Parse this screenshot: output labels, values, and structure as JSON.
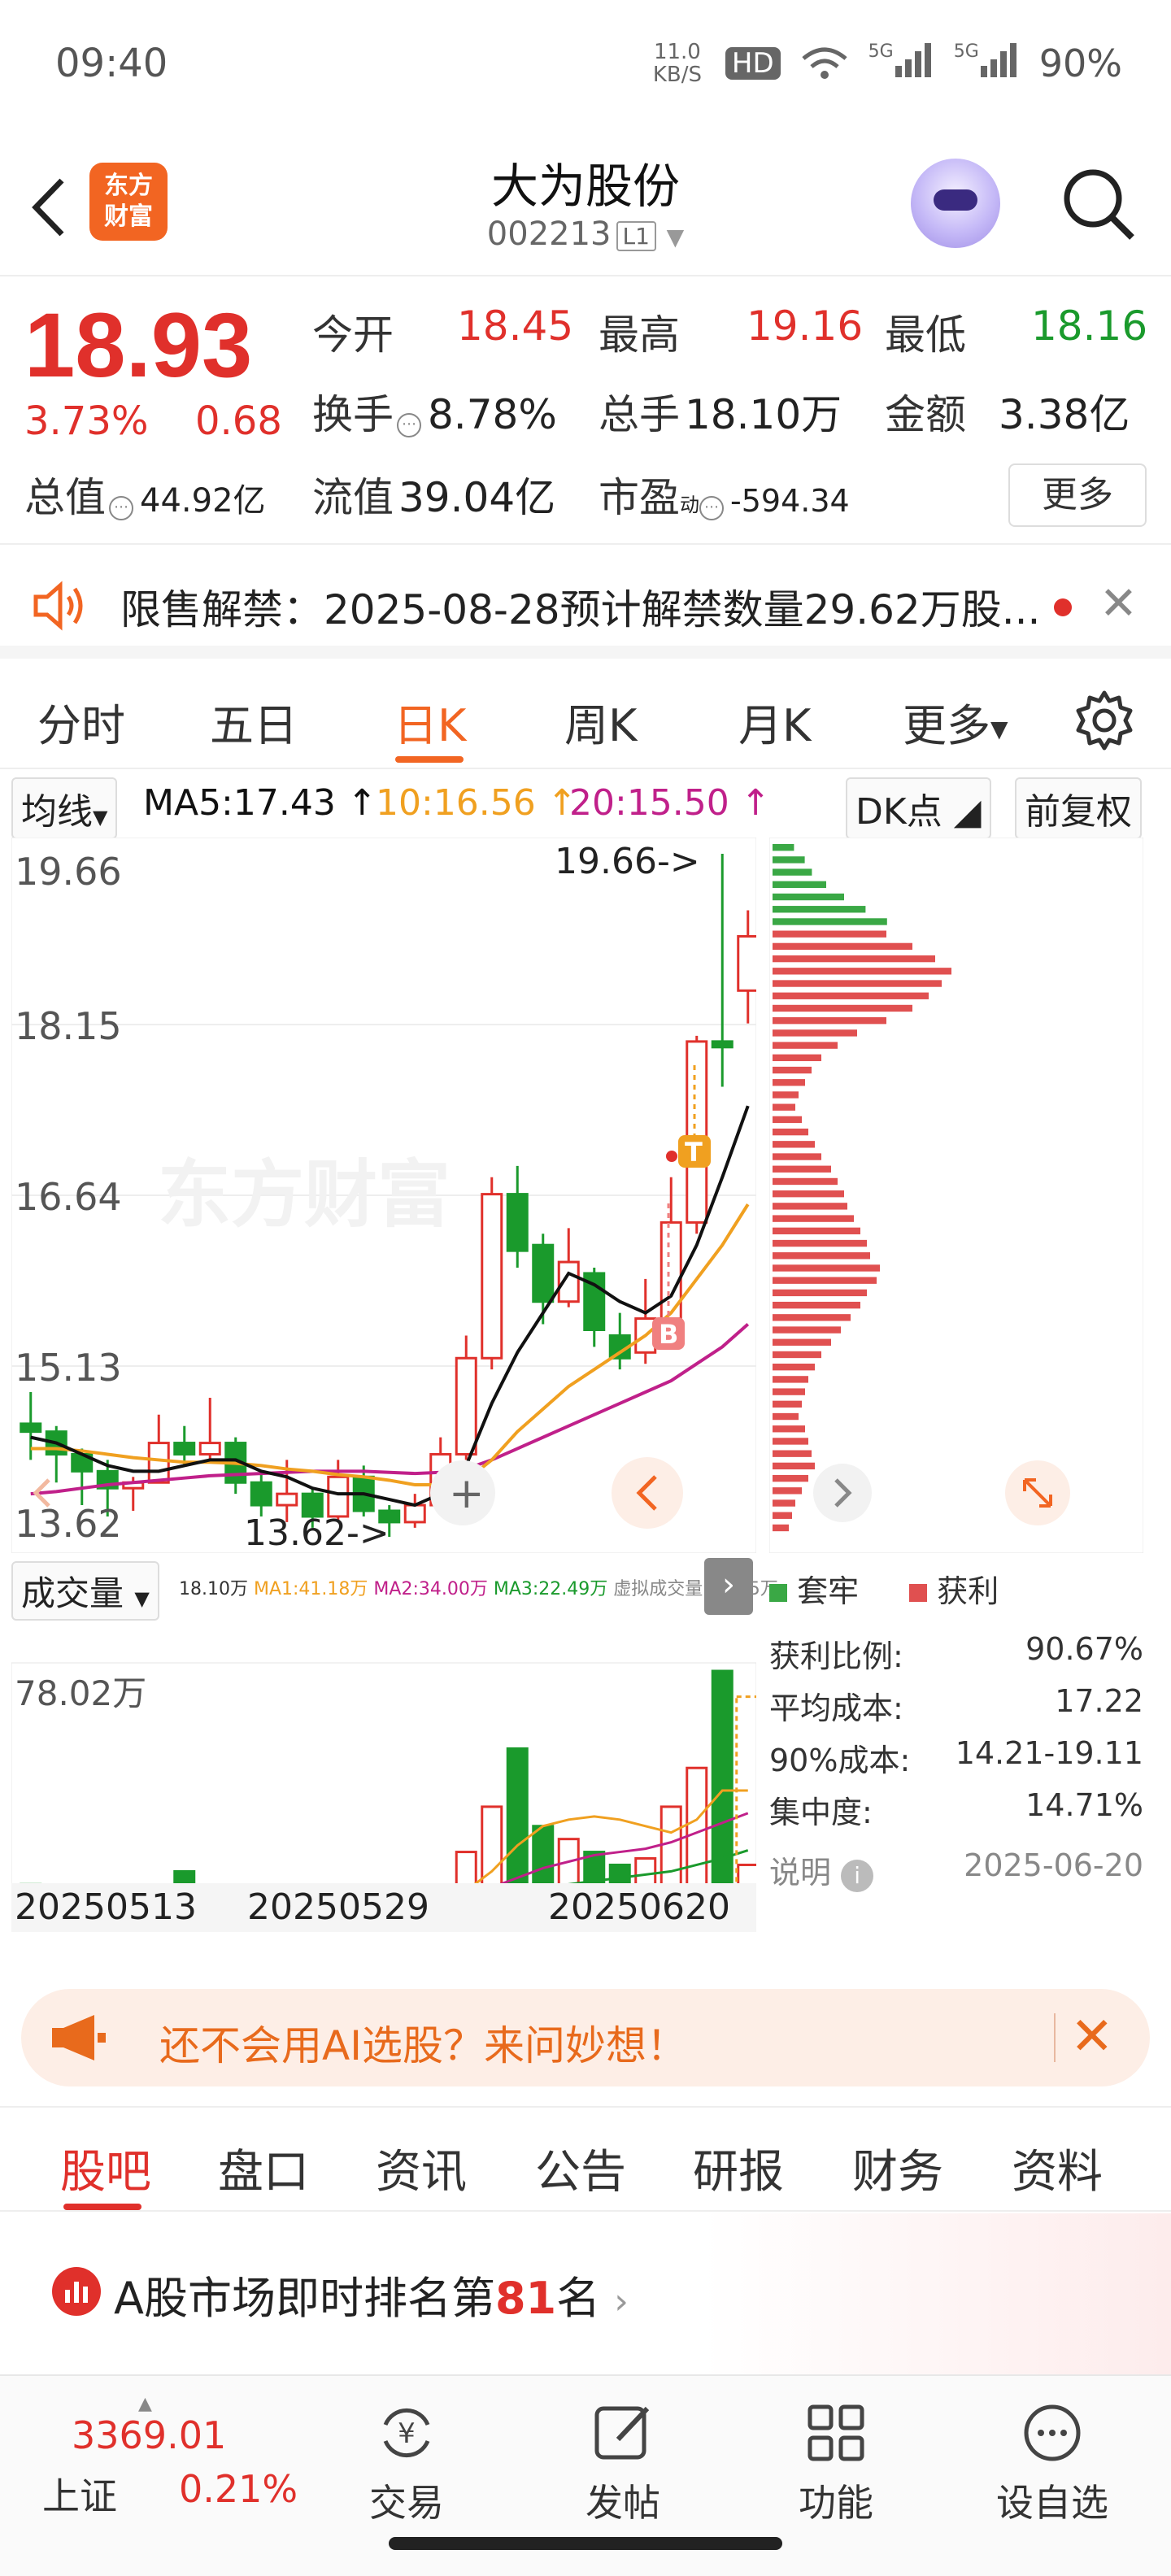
{
  "status_bar": {
    "time": "09:40",
    "speed": "11.0 KB/S",
    "hd": "HD",
    "battery": "90%",
    "net1": "5G",
    "net2": "5G"
  },
  "header": {
    "stock_name": "大为股份",
    "stock_code": "002213",
    "market_tag": "L1",
    "logo_text_1": "东方",
    "logo_text_2": "财富"
  },
  "quote": {
    "price": "18.93",
    "change_pct": "3.73%",
    "change_amt": "0.68",
    "open_label": "今开",
    "open": "18.45",
    "high_label": "最高",
    "high": "19.16",
    "low_label": "最低",
    "low": "18.16",
    "turnover_label": "换手",
    "turnover": "8.78%",
    "volume_label": "总手",
    "volume": "18.10万",
    "amount_label": "金额",
    "amount": "3.38亿",
    "mktcap_label": "总值",
    "mktcap": "44.92亿",
    "float_label": "流值",
    "float_cap": "39.04亿",
    "pe_label": "市盈",
    "pe_sup": "动",
    "pe": "-594.34",
    "more_button": "更多"
  },
  "notice": {
    "text": "限售解禁：2025-08-28预计解禁数量29.62万股..."
  },
  "chart_tabs": [
    "分时",
    "五日",
    "日K",
    "周K",
    "月K",
    "更多"
  ],
  "ma_row": {
    "selector": "均线",
    "ma5": "MA5:17.43",
    "ma10": "10:16.56",
    "ma20": "20:15.50",
    "dk": "DK点",
    "adjust": "前复权"
  },
  "kchart": {
    "y_labels": [
      "19.66",
      "18.15",
      "16.64",
      "15.13",
      "13.62"
    ],
    "max_marker": "19.66->",
    "min_marker": "13.62->",
    "watermark": "东方财富",
    "buy_marker": "B",
    "sell_marker": "T"
  },
  "volume": {
    "selector": "成交量",
    "v": "18.10万",
    "ma1": "MA1:41.18万",
    "ma2": "MA2:34.00万",
    "ma3": "MA3:22.49万",
    "virtual": "虚拟成交量:70.05万",
    "y_max": "78.02万",
    "dates": [
      "20250513",
      "20250529",
      "20250620"
    ]
  },
  "distribution": {
    "legend_trapped": "套牢",
    "legend_profit": "获利",
    "rows": [
      {
        "label": "获利比例:",
        "value": "90.67%"
      },
      {
        "label": "平均成本:",
        "value": "17.22"
      },
      {
        "label": "90%成本:",
        "value": "14.21-19.11"
      },
      {
        "label": "集中度:",
        "value": "14.71%"
      }
    ],
    "note_label": "说明",
    "date": "2025-06-20"
  },
  "ai_banner": {
    "text": "还不会用AI选股？来问妙想！"
  },
  "bottom_tabs": [
    "股吧",
    "盘口",
    "资讯",
    "公告",
    "研报",
    "财务",
    "资料"
  ],
  "rank": {
    "prefix": "A股市场即时排名第",
    "rank": "81",
    "suffix": "名"
  },
  "nav": {
    "index_value": "3369.01",
    "index_name": "上证",
    "index_change": "0.21%",
    "trade": "交易",
    "post": "发帖",
    "function": "功能",
    "watchlist": "设自选"
  },
  "colors": {
    "up": "#e0302b",
    "down": "#1a9a2c",
    "accent": "#f26522",
    "ma5": "#111111",
    "ma10": "#f0a020",
    "ma20": "#c0208a"
  },
  "chart_data": {
    "type": "candlestick",
    "y_range": [
      13.62,
      19.66
    ],
    "candles": [
      {
        "o": 14.62,
        "c": 14.55,
        "h": 14.9,
        "l": 14.3
      },
      {
        "o": 14.55,
        "c": 14.35,
        "h": 14.6,
        "l": 14.1
      },
      {
        "o": 14.35,
        "c": 14.2,
        "h": 14.4,
        "l": 13.9
      },
      {
        "o": 14.2,
        "c": 14.05,
        "h": 14.3,
        "l": 13.8
      },
      {
        "o": 14.05,
        "c": 14.1,
        "h": 14.15,
        "l": 13.85
      },
      {
        "o": 14.1,
        "c": 14.45,
        "h": 14.7,
        "l": 14.1
      },
      {
        "o": 14.45,
        "c": 14.35,
        "h": 14.6,
        "l": 14.25
      },
      {
        "o": 14.35,
        "c": 14.45,
        "h": 14.85,
        "l": 14.3
      },
      {
        "o": 14.45,
        "c": 14.1,
        "h": 14.5,
        "l": 14.0
      },
      {
        "o": 14.1,
        "c": 13.9,
        "h": 14.2,
        "l": 13.8
      },
      {
        "o": 13.9,
        "c": 14.0,
        "h": 14.3,
        "l": 13.75
      },
      {
        "o": 14.0,
        "c": 13.8,
        "h": 14.05,
        "l": 13.7
      },
      {
        "o": 13.8,
        "c": 14.15,
        "h": 14.3,
        "l": 13.75
      },
      {
        "o": 14.15,
        "c": 13.85,
        "h": 14.25,
        "l": 13.8
      },
      {
        "o": 13.85,
        "c": 13.75,
        "h": 13.9,
        "l": 13.62
      },
      {
        "o": 13.75,
        "c": 13.9,
        "h": 14.0,
        "l": 13.7
      },
      {
        "o": 13.9,
        "c": 14.35,
        "h": 14.5,
        "l": 13.9
      },
      {
        "o": 14.35,
        "c": 15.2,
        "h": 15.4,
        "l": 14.3
      },
      {
        "o": 15.2,
        "c": 16.65,
        "h": 16.8,
        "l": 15.1
      },
      {
        "o": 16.65,
        "c": 16.15,
        "h": 16.9,
        "l": 16.0
      },
      {
        "o": 16.2,
        "c": 15.7,
        "h": 16.3,
        "l": 15.5
      },
      {
        "o": 15.7,
        "c": 16.05,
        "h": 16.35,
        "l": 15.65
      },
      {
        "o": 15.95,
        "c": 15.45,
        "h": 16.0,
        "l": 15.3
      },
      {
        "o": 15.4,
        "c": 15.2,
        "h": 15.6,
        "l": 15.1
      },
      {
        "o": 15.25,
        "c": 15.55,
        "h": 15.9,
        "l": 15.15
      },
      {
        "o": 15.55,
        "c": 16.4,
        "h": 16.8,
        "l": 15.5
      },
      {
        "o": 16.4,
        "c": 18.0,
        "h": 18.05,
        "l": 16.3
      },
      {
        "o": 18.0,
        "c": 17.95,
        "h": 19.66,
        "l": 17.6
      },
      {
        "o": 18.45,
        "c": 18.93,
        "h": 19.16,
        "l": 18.16
      }
    ],
    "ma5": [
      14.5,
      14.45,
      14.35,
      14.25,
      14.2,
      14.2,
      14.25,
      14.3,
      14.3,
      14.2,
      14.15,
      14.05,
      14.0,
      14.0,
      13.95,
      13.9,
      14.0,
      14.25,
      14.8,
      15.25,
      15.6,
      15.95,
      15.85,
      15.7,
      15.6,
      15.75,
      16.2,
      16.8,
      17.43
    ],
    "ma10": [
      14.4,
      14.4,
      14.38,
      14.35,
      14.32,
      14.3,
      14.28,
      14.28,
      14.27,
      14.25,
      14.22,
      14.2,
      14.17,
      14.15,
      14.12,
      14.08,
      14.08,
      14.12,
      14.3,
      14.55,
      14.75,
      14.95,
      15.1,
      15.25,
      15.4,
      15.6,
      15.9,
      16.2,
      16.56
    ],
    "ma20": [
      14.0,
      14.02,
      14.05,
      14.08,
      14.1,
      14.12,
      14.14,
      14.16,
      14.17,
      14.18,
      14.19,
      14.2,
      14.2,
      14.2,
      14.19,
      14.18,
      14.19,
      14.22,
      14.3,
      14.4,
      14.5,
      14.6,
      14.7,
      14.8,
      14.9,
      15.0,
      15.15,
      15.3,
      15.5
    ],
    "volumes": [
      12,
      8,
      6,
      6,
      10,
      6,
      16,
      8,
      6,
      6,
      8,
      6,
      6,
      8,
      5,
      6,
      8,
      22,
      36,
      54,
      30,
      26,
      22,
      18,
      20,
      36,
      48,
      78,
      18
    ],
    "vol_ma1": [
      10,
      10,
      9,
      8,
      8,
      8,
      9,
      9,
      8,
      8,
      8,
      7,
      7,
      7,
      7,
      7,
      7,
      10,
      16,
      24,
      30,
      32,
      33,
      32,
      30,
      28,
      32,
      41,
      41
    ],
    "vol_ma2": [
      9,
      9,
      9,
      9,
      9,
      9,
      9,
      9,
      9,
      9,
      9,
      8,
      8,
      8,
      8,
      8,
      8,
      9,
      11,
      14,
      17,
      19,
      21,
      22,
      23,
      25,
      28,
      31,
      34
    ],
    "vol_ma3": [
      8,
      8,
      8,
      8,
      8,
      8,
      8,
      8,
      8,
      8,
      8,
      8,
      8,
      8,
      8,
      8,
      8,
      8,
      9,
      10,
      11,
      12,
      13,
      14,
      15,
      16,
      18,
      20,
      22.49
    ],
    "dist_trapped": [
      12,
      18,
      22,
      30,
      40,
      52,
      64
    ],
    "dist_profit": [
      70,
      86,
      100,
      110,
      104,
      96,
      86,
      70,
      52,
      40,
      30,
      24,
      20,
      16,
      14,
      18,
      22,
      26,
      30,
      36,
      40,
      44,
      46,
      50,
      54,
      58,
      60,
      66,
      64,
      58,
      54,
      48,
      42,
      36,
      30,
      26,
      22,
      20,
      18,
      16,
      20,
      22,
      24,
      26,
      22,
      18,
      14,
      12,
      10
    ]
  }
}
